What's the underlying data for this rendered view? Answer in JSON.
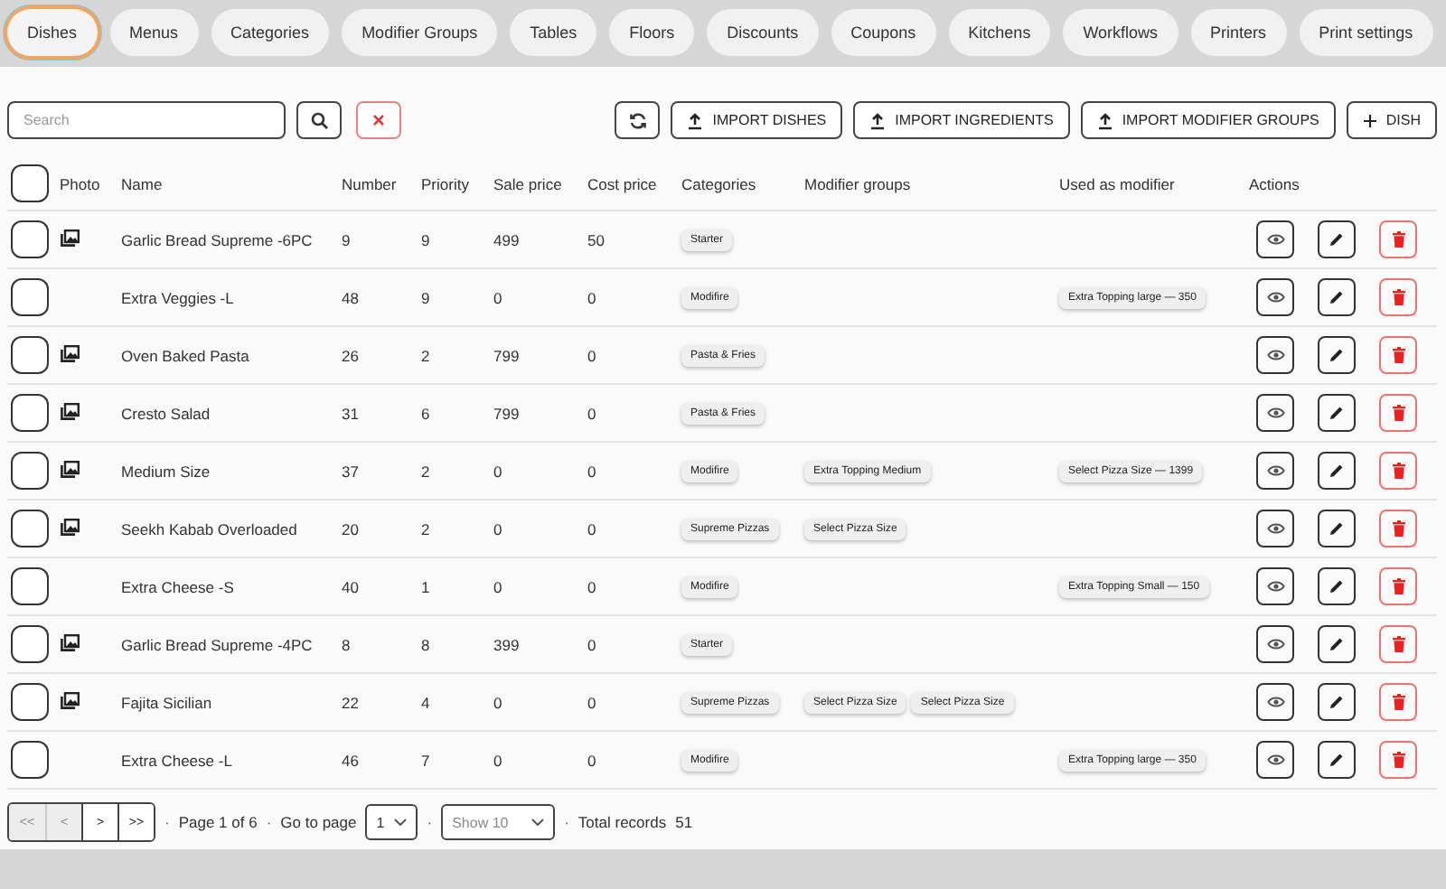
{
  "tabs": [
    {
      "label": "Dishes",
      "selected": true
    },
    {
      "label": "Menus",
      "selected": false
    },
    {
      "label": "Categories",
      "selected": false
    },
    {
      "label": "Modifier Groups",
      "selected": false
    },
    {
      "label": "Tables",
      "selected": false
    },
    {
      "label": "Floors",
      "selected": false
    },
    {
      "label": "Discounts",
      "selected": false
    },
    {
      "label": "Coupons",
      "selected": false
    },
    {
      "label": "Kitchens",
      "selected": false
    },
    {
      "label": "Workflows",
      "selected": false
    },
    {
      "label": "Printers",
      "selected": false
    },
    {
      "label": "Print settings",
      "selected": false
    }
  ],
  "search": {
    "placeholder": "Search"
  },
  "toolbar": {
    "buttons": [
      {
        "kind": "refresh"
      },
      {
        "kind": "import",
        "label": "IMPORT DISHES"
      },
      {
        "kind": "import",
        "label": "IMPORT INGREDIENTS"
      },
      {
        "kind": "import",
        "label": "IMPORT MODIFIER GROUPS"
      },
      {
        "kind": "add",
        "label": "DISH"
      }
    ]
  },
  "table": {
    "select_all": {
      "checked": false
    },
    "columns": [
      "Photo",
      "Name",
      "Number",
      "Priority",
      "Sale price",
      "Cost price",
      "Categories",
      "Modifier groups",
      "Used as modifier",
      "Actions"
    ],
    "rows": [
      {
        "checked": false,
        "has_photo": true,
        "name": "Garlic Bread Supreme -6PC",
        "number": "9",
        "priority": "9",
        "sale_price": "499",
        "cost_price": "50",
        "categories": [
          "Starter"
        ],
        "modifier_groups": [],
        "used_as_modifier": []
      },
      {
        "checked": false,
        "has_photo": false,
        "name": "Extra Veggies -L",
        "number": "48",
        "priority": "9",
        "sale_price": "0",
        "cost_price": "0",
        "categories": [
          "Modifire"
        ],
        "modifier_groups": [],
        "used_as_modifier": [
          "Extra Topping large — 350"
        ]
      },
      {
        "checked": false,
        "has_photo": true,
        "name": "Oven Baked Pasta",
        "number": "26",
        "priority": "2",
        "sale_price": "799",
        "cost_price": "0",
        "categories": [
          "Pasta & Fries"
        ],
        "modifier_groups": [],
        "used_as_modifier": []
      },
      {
        "checked": false,
        "has_photo": true,
        "name": "Cresto Salad",
        "number": "31",
        "priority": "6",
        "sale_price": "799",
        "cost_price": "0",
        "categories": [
          "Pasta & Fries"
        ],
        "modifier_groups": [],
        "used_as_modifier": []
      },
      {
        "checked": false,
        "has_photo": true,
        "name": "Medium Size",
        "number": "37",
        "priority": "2",
        "sale_price": "0",
        "cost_price": "0",
        "categories": [
          "Modifire"
        ],
        "modifier_groups": [
          "Extra Topping Medium"
        ],
        "used_as_modifier": [
          "Select Pizza Size — 1399"
        ]
      },
      {
        "checked": false,
        "has_photo": true,
        "name": "Seekh Kabab Overloaded",
        "number": "20",
        "priority": "2",
        "sale_price": "0",
        "cost_price": "0",
        "categories": [
          "Supreme Pizzas"
        ],
        "modifier_groups": [
          "Select Pizza Size"
        ],
        "used_as_modifier": []
      },
      {
        "checked": false,
        "has_photo": false,
        "name": "Extra Cheese -S",
        "number": "40",
        "priority": "1",
        "sale_price": "0",
        "cost_price": "0",
        "categories": [
          "Modifire"
        ],
        "modifier_groups": [],
        "used_as_modifier": [
          "Extra Topping Small — 150"
        ]
      },
      {
        "checked": false,
        "has_photo": true,
        "name": "Garlic Bread Supreme -4PC",
        "number": "8",
        "priority": "8",
        "sale_price": "399",
        "cost_price": "0",
        "categories": [
          "Starter"
        ],
        "modifier_groups": [],
        "used_as_modifier": []
      },
      {
        "checked": false,
        "has_photo": true,
        "name": "Fajita Sicilian",
        "number": "22",
        "priority": "4",
        "sale_price": "0",
        "cost_price": "0",
        "categories": [
          "Supreme Pizzas"
        ],
        "modifier_groups": [
          "Select Pizza Size",
          "Select Pizza Size"
        ],
        "used_as_modifier": []
      },
      {
        "checked": false,
        "has_photo": false,
        "name": "Extra Cheese -L",
        "number": "46",
        "priority": "7",
        "sale_price": "0",
        "cost_price": "0",
        "categories": [
          "Modifire"
        ],
        "modifier_groups": [],
        "used_as_modifier": [
          "Extra Topping large — 350"
        ]
      }
    ]
  },
  "pagination": {
    "buttons": [
      {
        "label": "<<",
        "disabled": true
      },
      {
        "label": "<",
        "disabled": true
      },
      {
        "label": ">",
        "disabled": false
      },
      {
        "label": ">>",
        "disabled": false
      }
    ],
    "separator": "·",
    "page_info": "Page 1 of 6",
    "goto_label": "Go to page",
    "goto_value": "1",
    "page_size": "Show 10",
    "total_label": "Total records",
    "total": "51"
  }
}
